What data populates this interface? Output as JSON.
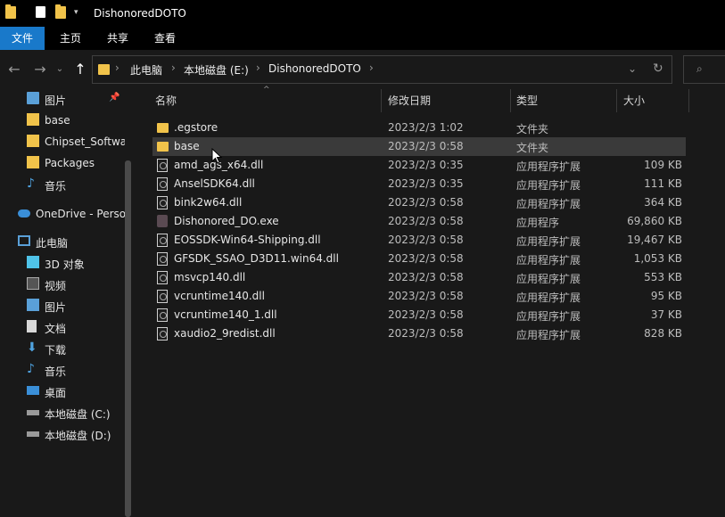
{
  "window": {
    "title": "DishonoredDOTO"
  },
  "ribbon": {
    "tabs": [
      "文件",
      "主页",
      "共享",
      "查看"
    ]
  },
  "nav": {
    "back_icon": "arrow-left-icon",
    "forward_icon": "arrow-right-icon",
    "up_icon": "arrow-up-icon",
    "breadcrumb": [
      "此电脑",
      "本地磁盘 (E:)",
      "DishonoredDOTO"
    ],
    "search_icon": "search-icon"
  },
  "sidebar": {
    "items": [
      {
        "label": "图片",
        "icon": "pictures-icon"
      },
      {
        "label": "base",
        "icon": "folder-icon"
      },
      {
        "label": "Chipset_Software",
        "icon": "folder-icon"
      },
      {
        "label": "Packages",
        "icon": "folder-icon"
      },
      {
        "label": "音乐",
        "icon": "music-icon"
      },
      {
        "label": "OneDrive - Personal",
        "icon": "cloud-icon"
      },
      {
        "label": "此电脑",
        "icon": "computer-icon"
      },
      {
        "label": "3D 对象",
        "icon": "cube-icon"
      },
      {
        "label": "视频",
        "icon": "video-icon"
      },
      {
        "label": "图片",
        "icon": "pictures-icon"
      },
      {
        "label": "文档",
        "icon": "document-icon"
      },
      {
        "label": "下载",
        "icon": "download-icon"
      },
      {
        "label": "音乐",
        "icon": "music-icon"
      },
      {
        "label": "桌面",
        "icon": "desktop-icon"
      },
      {
        "label": "本地磁盘 (C:)",
        "icon": "drive-icon"
      },
      {
        "label": "本地磁盘 (D:)",
        "icon": "drive-icon"
      }
    ]
  },
  "columns": {
    "name": "名称",
    "date": "修改日期",
    "type": "类型",
    "size": "大小"
  },
  "files": [
    {
      "name": ".egstore",
      "date": "2023/2/3 1:02",
      "type": "文件夹",
      "size": "",
      "kind": "folder"
    },
    {
      "name": "base",
      "date": "2023/2/3 0:58",
      "type": "文件夹",
      "size": "",
      "kind": "folder"
    },
    {
      "name": "amd_ags_x64.dll",
      "date": "2023/2/3 0:35",
      "type": "应用程序扩展",
      "size": "109 KB",
      "kind": "dll"
    },
    {
      "name": "AnselSDK64.dll",
      "date": "2023/2/3 0:35",
      "type": "应用程序扩展",
      "size": "111 KB",
      "kind": "dll"
    },
    {
      "name": "bink2w64.dll",
      "date": "2023/2/3 0:58",
      "type": "应用程序扩展",
      "size": "364 KB",
      "kind": "dll"
    },
    {
      "name": "Dishonored_DO.exe",
      "date": "2023/2/3 0:58",
      "type": "应用程序",
      "size": "69,860 KB",
      "kind": "exe"
    },
    {
      "name": "EOSSDK-Win64-Shipping.dll",
      "date": "2023/2/3 0:58",
      "type": "应用程序扩展",
      "size": "19,467 KB",
      "kind": "dll"
    },
    {
      "name": "GFSDK_SSAO_D3D11.win64.dll",
      "date": "2023/2/3 0:58",
      "type": "应用程序扩展",
      "size": "1,053 KB",
      "kind": "dll"
    },
    {
      "name": "msvcp140.dll",
      "date": "2023/2/3 0:58",
      "type": "应用程序扩展",
      "size": "553 KB",
      "kind": "dll"
    },
    {
      "name": "vcruntime140.dll",
      "date": "2023/2/3 0:58",
      "type": "应用程序扩展",
      "size": "95 KB",
      "kind": "dll"
    },
    {
      "name": "vcruntime140_1.dll",
      "date": "2023/2/3 0:58",
      "type": "应用程序扩展",
      "size": "37 KB",
      "kind": "dll"
    },
    {
      "name": "xaudio2_9redist.dll",
      "date": "2023/2/3 0:58",
      "type": "应用程序扩展",
      "size": "828 KB",
      "kind": "dll"
    }
  ],
  "colors": {
    "accent": "#1979ca",
    "folder": "#f1c34a",
    "background": "#191919"
  }
}
